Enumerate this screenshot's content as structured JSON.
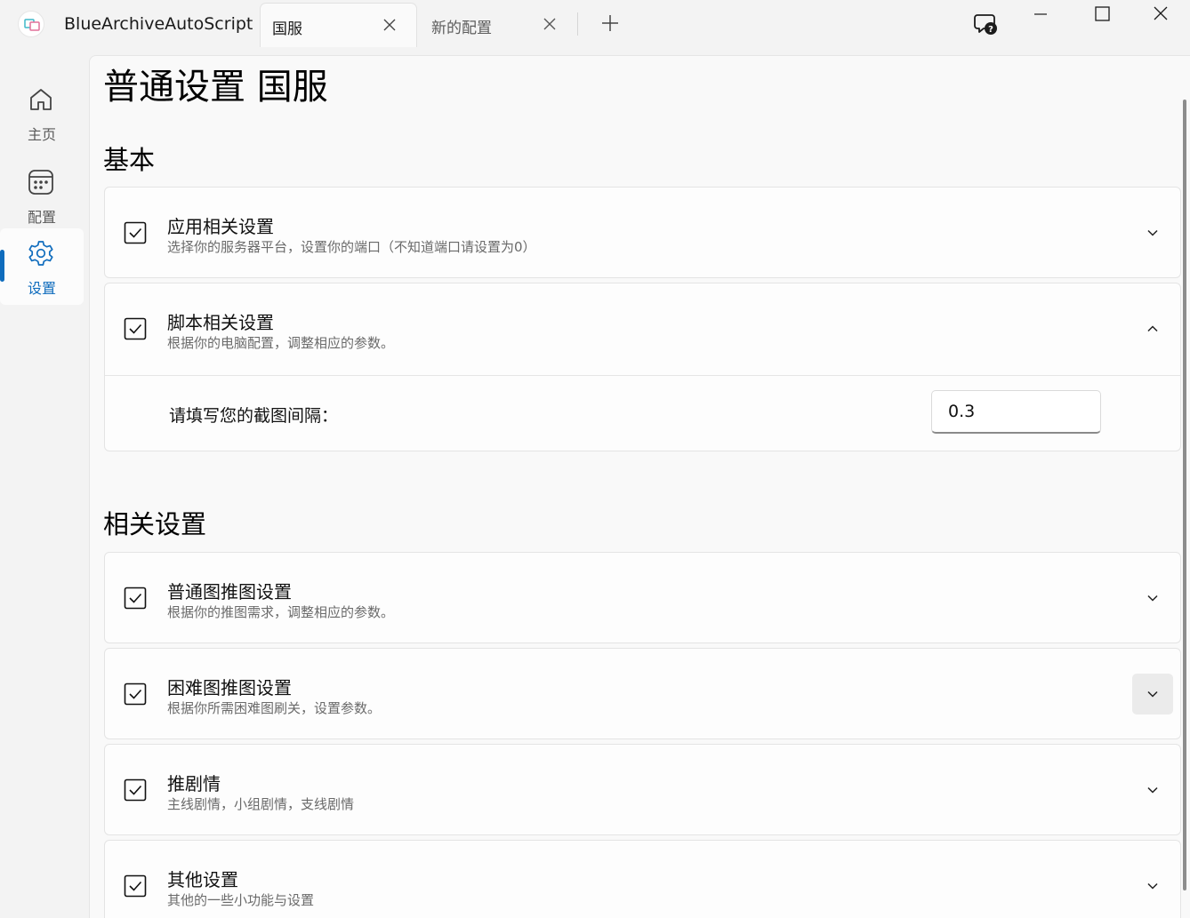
{
  "app": {
    "title": "BlueArchiveAutoScript"
  },
  "tabs": [
    {
      "label": "国服",
      "active": true
    },
    {
      "label": "新的配置",
      "active": false
    }
  ],
  "nav": {
    "items": [
      {
        "label": "主页",
        "icon": "home-icon"
      },
      {
        "label": "配置",
        "icon": "calendar-icon"
      },
      {
        "label": "设置",
        "icon": "gear-icon",
        "selected": true
      }
    ]
  },
  "page": {
    "title": "普通设置 国服",
    "sections": [
      {
        "title": "基本",
        "cards": [
          {
            "title": "应用相关设置",
            "desc": "选择你的服务器平台，设置你的端口（不知道端口请设置为0）",
            "checked": true,
            "expanded": false
          },
          {
            "title": "脚本相关设置",
            "desc": "根据你的电脑配置，调整相应的参数。",
            "checked": true,
            "expanded": true,
            "field": {
              "label": "请填写您的截图间隔：",
              "value": "0.3"
            }
          }
        ]
      },
      {
        "title": "相关设置",
        "cards": [
          {
            "title": "普通图推图设置",
            "desc": "根据你的推图需求，调整相应的参数。",
            "checked": true,
            "expanded": false
          },
          {
            "title": "困难图推图设置",
            "desc": "根据你所需困难图刷关，设置参数。",
            "checked": true,
            "expanded": false,
            "hover": true
          },
          {
            "title": "推剧情",
            "desc": "主线剧情，小组剧情，支线剧情",
            "checked": true,
            "expanded": false
          },
          {
            "title": "其他设置",
            "desc": "其他的一些小功能与设置",
            "checked": true,
            "expanded": false
          }
        ]
      }
    ]
  },
  "colors": {
    "accent": "#0f6cbd",
    "background": "#f3f3f3",
    "panel": "#f9f9f9",
    "card": "#fdfdfd"
  }
}
